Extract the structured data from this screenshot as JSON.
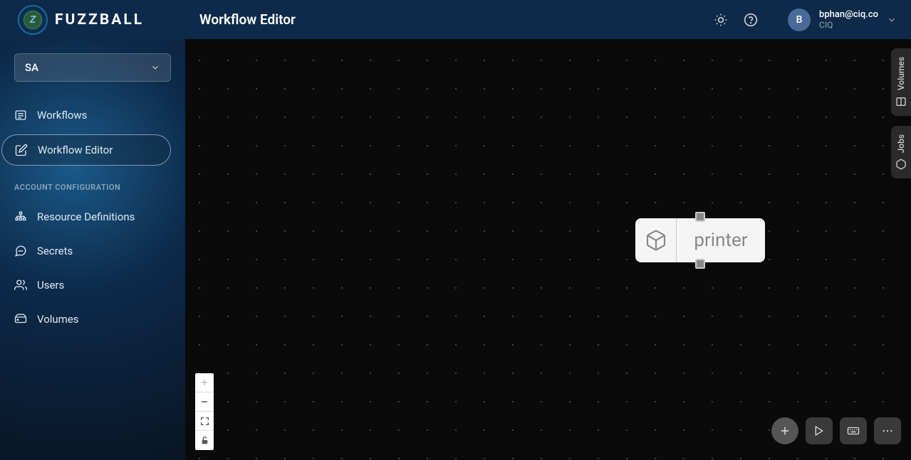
{
  "header": {
    "logoText": "FUZZBALL",
    "pageTitle": "Workflow Editor",
    "user": {
      "initial": "B",
      "email": "bphan@ciq.co",
      "company": "CIQ"
    }
  },
  "sidebar": {
    "orgSelector": "SA",
    "nav": {
      "workflows": "Workflows",
      "workflowEditor": "Workflow Editor"
    },
    "sectionHeader": "ACCOUNT CONFIGURATION",
    "config": {
      "resourceDefinitions": "Resource Definitions",
      "secrets": "Secrets",
      "users": "Users",
      "volumes": "Volumes"
    }
  },
  "canvas": {
    "node": {
      "label": "printer"
    }
  },
  "sideTabs": {
    "volumes": "Volumes",
    "jobs": "Jobs"
  }
}
